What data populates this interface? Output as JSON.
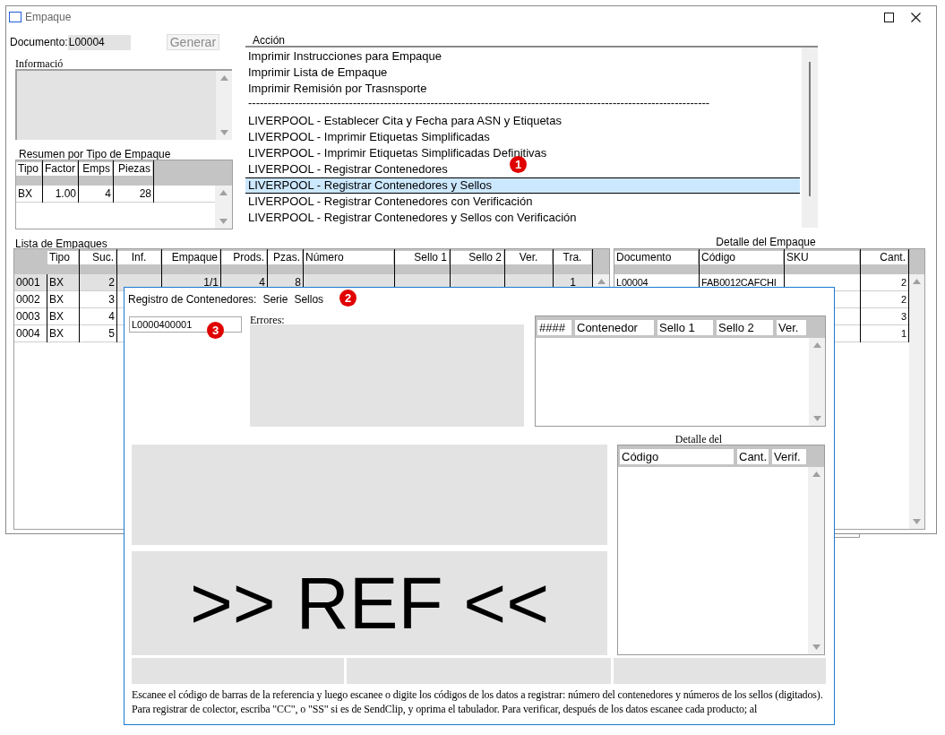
{
  "window": {
    "title": "Empaque"
  },
  "document": {
    "label": "Documento:",
    "value": "L00004"
  },
  "generate_button": {
    "label": "Generar",
    "disabled": true
  },
  "info": {
    "label": "Informació"
  },
  "summary": {
    "title": "Resumen por Tipo de Empaque",
    "columns": [
      {
        "label": "Tipo"
      },
      {
        "label": "Factor"
      },
      {
        "label": "Emps"
      },
      {
        "label": "Piezas"
      }
    ],
    "rows": [
      {
        "cells": [
          "BX",
          "1.00",
          "4",
          "28"
        ],
        "selected": false
      }
    ]
  },
  "action": {
    "label": "Acción",
    "items": [
      {
        "kind": "item",
        "text": "Imprimir Instrucciones para Empaque",
        "selected": false
      },
      {
        "kind": "item",
        "text": "Imprimir Lista de Empaque",
        "selected": false
      },
      {
        "kind": "item",
        "text": "Imprimir Remisión por Trasnsporte",
        "selected": false
      },
      {
        "kind": "separator",
        "text": "-----------------------------------------------------------------------------------------------------------------------"
      },
      {
        "kind": "item",
        "text": "LIVERPOOL - Establecer Cita y Fecha para ASN y Etiquetas",
        "selected": false
      },
      {
        "kind": "item",
        "text": "LIVERPOOL - Imprimir Etiquetas Simplificadas",
        "selected": false
      },
      {
        "kind": "item",
        "text": "LIVERPOOL - Imprimir Etiquetas Simplificadas Definitivas",
        "selected": false
      },
      {
        "kind": "item",
        "text": "LIVERPOOL - Registrar Contenedores",
        "selected": false
      },
      {
        "kind": "item",
        "text": "LIVERPOOL - Registrar Contenedores y Sellos",
        "selected": true
      },
      {
        "kind": "item",
        "text": "LIVERPOOL - Registrar Contenedores con Verificación",
        "selected": false
      },
      {
        "kind": "item",
        "text": "LIVERPOOL - Registrar Contenedores y Sellos con Verificación",
        "selected": false
      }
    ]
  },
  "packages": {
    "title": "Lista de Empaques",
    "columns": [
      {},
      {
        "label": "Tipo"
      },
      {
        "label": "Suc."
      },
      {
        "label": "Inf."
      },
      {
        "label": "Empaque"
      },
      {
        "label": "Prods."
      },
      {
        "label": "Pzas."
      },
      {
        "label": "Número"
      },
      {
        "label": "Sello 1"
      },
      {
        "label": "Sello 2"
      },
      {
        "label": "Ver."
      },
      {
        "label": "Tra."
      }
    ],
    "rows": [
      {
        "cells": [
          "0001",
          "BX",
          "2",
          "",
          "1/1",
          "4",
          "8",
          "",
          "",
          "",
          "",
          "1"
        ],
        "selected": true
      },
      {
        "cells": [
          "0002",
          "BX",
          "3"
        ],
        "selected": false
      },
      {
        "cells": [
          "0003",
          "BX",
          "4"
        ],
        "selected": false
      },
      {
        "cells": [
          "0004",
          "BX",
          "5"
        ],
        "selected": false
      }
    ]
  },
  "detail": {
    "title": "Detalle del Empaque",
    "columns": [
      {
        "label": "Documento"
      },
      {
        "label": "Código"
      },
      {
        "label": "SKU"
      },
      {
        "label": "Cant."
      }
    ],
    "rows": [
      {
        "cells": [
          "L00004",
          "FAB0012CAFCHI",
          "",
          "2"
        ],
        "selected": false
      },
      {
        "cells": [
          "",
          "",
          "",
          "2"
        ],
        "selected": false
      },
      {
        "cells": [
          "",
          "",
          "",
          "3"
        ],
        "selected": false
      },
      {
        "cells": [
          "",
          "",
          "",
          "1"
        ],
        "selected": false
      }
    ]
  },
  "dialog": {
    "title": "Registro de Contenedores:",
    "labels": [
      "Serie",
      "Sellos"
    ],
    "input_value": "L0000400001",
    "errors_label": "Errores:",
    "containers_columns": [
      "####",
      "Contenedor",
      "Sello 1",
      "Sello 2",
      "Ver."
    ],
    "detail_title": "Detalle del",
    "detail_columns": [
      "Código",
      "Cant.",
      "Verif."
    ],
    "reference": ">> REF <<",
    "instructions": "Escanee el código de barras de la referencia y luego escanee o digite los códigos de los datos a registrar: número del contenedores y números de los sellos (digitados). Para registrar de colector, escriba \"CC\", o \"SS\" si es de SendClip, y oprima el tabulador. Para verificar, después de los datos escanee cada producto; al"
  },
  "badges": [
    "1",
    "2",
    "3"
  ]
}
